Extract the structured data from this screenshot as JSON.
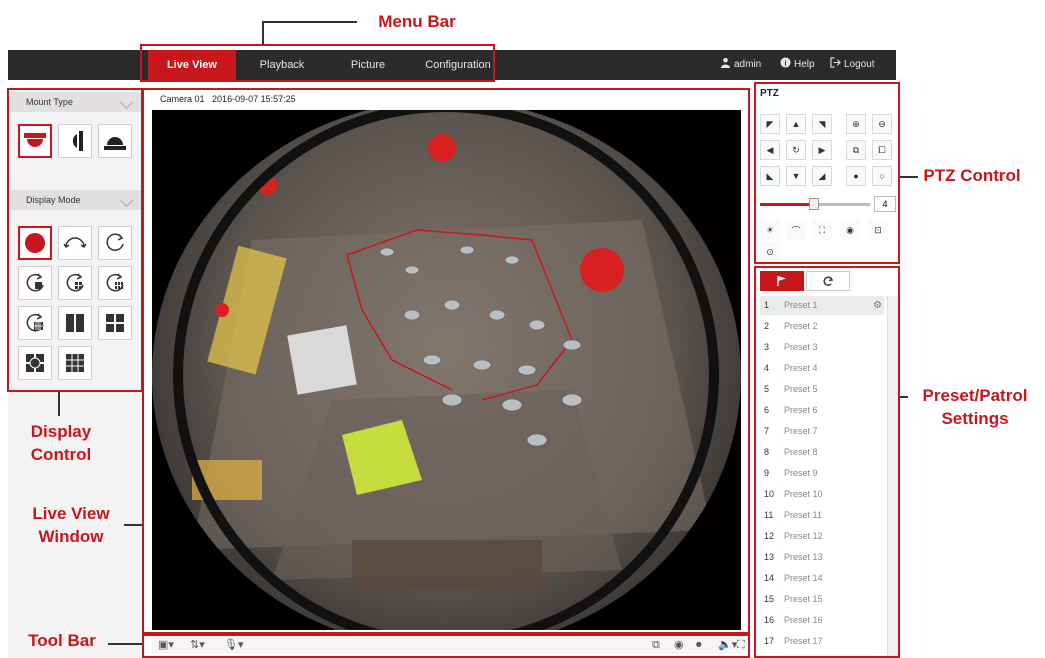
{
  "menubar": {
    "tabs": [
      {
        "label": "Live View",
        "active": true
      },
      {
        "label": "Playback",
        "active": false
      },
      {
        "label": "Picture",
        "active": false
      },
      {
        "label": "Configuration",
        "active": false
      }
    ],
    "user": "admin",
    "help": "Help",
    "logout": "Logout"
  },
  "left_panel": {
    "mount_type_label": "Mount Type",
    "display_mode_label": "Display Mode"
  },
  "live_view": {
    "camera": "Camera 01",
    "timestamp": "2016-09-07 15:57:25"
  },
  "ptz": {
    "title": "PTZ",
    "speed": "4"
  },
  "presets": [
    {
      "num": "1",
      "name": "Preset 1"
    },
    {
      "num": "2",
      "name": "Preset 2"
    },
    {
      "num": "3",
      "name": "Preset 3"
    },
    {
      "num": "4",
      "name": "Preset 4"
    },
    {
      "num": "5",
      "name": "Preset 5"
    },
    {
      "num": "6",
      "name": "Preset 6"
    },
    {
      "num": "7",
      "name": "Preset 7"
    },
    {
      "num": "8",
      "name": "Preset 8"
    },
    {
      "num": "9",
      "name": "Preset 9"
    },
    {
      "num": "10",
      "name": "Preset 10"
    },
    {
      "num": "11",
      "name": "Preset 11"
    },
    {
      "num": "12",
      "name": "Preset 12"
    },
    {
      "num": "13",
      "name": "Preset 13"
    },
    {
      "num": "14",
      "name": "Preset 14"
    },
    {
      "num": "15",
      "name": "Preset 15"
    },
    {
      "num": "16",
      "name": "Preset 16"
    },
    {
      "num": "17",
      "name": "Preset 17"
    }
  ],
  "annotations": {
    "menu_bar": "Menu Bar",
    "ptz_control": "PTZ Control",
    "preset_patrol": "Preset/Patrol Settings",
    "display_control": "Display Control",
    "live_view_window": "Live View Window",
    "tool_bar": "Tool Bar"
  },
  "colors": {
    "accent": "#c8161d",
    "menubar_bg": "#2b2b2b"
  }
}
